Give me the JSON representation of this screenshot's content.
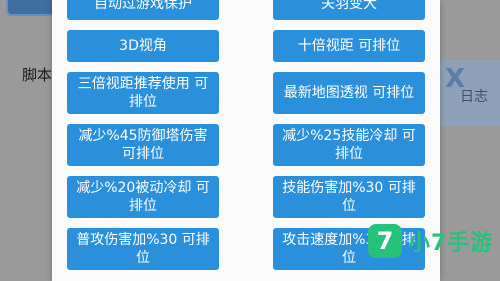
{
  "background": {
    "script_label": "脚本",
    "log_label": "日志"
  },
  "options": [
    {
      "label": "自动过游戏保护"
    },
    {
      "label": "关羽变大"
    },
    {
      "label": "3D视角"
    },
    {
      "label": "十倍视距  可排位"
    },
    {
      "label": "三倍视距推荐使用 可排位"
    },
    {
      "label": "最新地图透视  可排位"
    },
    {
      "label": "减少%45防御塔伤害  可排位"
    },
    {
      "label": "减少%25技能冷却 可排位"
    },
    {
      "label": "减少%20被动冷却 可排位"
    },
    {
      "label": "技能伤害加%30  可排位"
    },
    {
      "label": "普攻伤害加%30  可排位"
    },
    {
      "label": "攻击速度加%30  可排位"
    }
  ],
  "watermark": {
    "logo_icon": "xiao7-logo-icon",
    "text": "小7手游"
  },
  "colors": {
    "button_bg": "#2a90dc",
    "button_text": "#ffffff",
    "watermark_green": "#27c27a"
  }
}
